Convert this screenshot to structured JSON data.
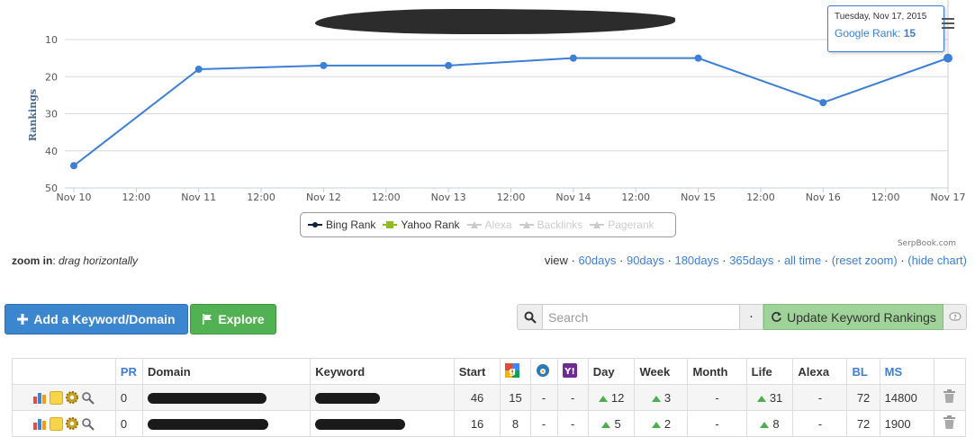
{
  "chart": {
    "y_axis_title": "Rankings",
    "credit": "SerpBook.com",
    "menu_icon": "hamburger-menu-icon"
  },
  "chart_data": {
    "type": "line",
    "title": "",
    "ylabel": "Rankings",
    "ylim": [
      10,
      50
    ],
    "y_reversed": true,
    "y_ticks": [
      10,
      20,
      30,
      40,
      50
    ],
    "x_ticks": [
      "Nov 10",
      "12:00",
      "Nov 11",
      "12:00",
      "Nov 12",
      "12:00",
      "Nov 13",
      "12:00",
      "Nov 14",
      "12:00",
      "Nov 15",
      "12:00",
      "Nov 16",
      "12:00",
      "Nov 17"
    ],
    "x": [
      "Nov 10",
      "Nov 11",
      "Nov 12",
      "Nov 13",
      "Nov 14",
      "Nov 15",
      "Nov 16",
      "Nov 17"
    ],
    "series": [
      {
        "name": "Google Rank",
        "color": "#3b7fd6",
        "values": [
          44,
          18,
          17,
          17,
          15,
          15,
          27,
          15
        ]
      }
    ],
    "grid": true,
    "legend_placement": "bottom-center"
  },
  "tooltip": {
    "date": "Tuesday, Nov 17, 2015",
    "label": "Google Rank:",
    "value": "15"
  },
  "legend": {
    "items": [
      {
        "label": "Bing Rank",
        "color": "#0d233a",
        "active": true
      },
      {
        "label": "Yahoo Rank",
        "color": "#8bbc21",
        "active": true
      },
      {
        "label": "Alexa",
        "color": "#cccccc",
        "active": false
      },
      {
        "label": "Backlinks",
        "color": "#cccccc",
        "active": false
      },
      {
        "label": "Pagerank",
        "color": "#cccccc",
        "active": false
      }
    ]
  },
  "zoom": {
    "label": "zoom in",
    "hint": "drag horizontally"
  },
  "view": {
    "label": "view",
    "links": [
      "60days",
      "90days",
      "180days",
      "365days",
      "all time",
      "(reset zoom)",
      "(hide chart)"
    ]
  },
  "buttons": {
    "add_label": "Add a Keyword/Domain",
    "explore_label": "Explore",
    "update_label": "Update Keyword Rankings"
  },
  "search": {
    "placeholder": "Search",
    "dot": "·"
  },
  "table": {
    "headers": {
      "pr": "PR",
      "domain": "Domain",
      "keyword": "Keyword",
      "start": "Start",
      "day": "Day",
      "week": "Week",
      "month": "Month",
      "life": "Life",
      "alexa": "Alexa",
      "bl": "BL",
      "ms": "MS"
    },
    "rows": [
      {
        "pr": "0",
        "start": "46",
        "google": "15",
        "bing": "-",
        "yahoo": "-",
        "day": "12",
        "week": "3",
        "month": "-",
        "life": "31",
        "alexa": "-",
        "bl": "72",
        "ms": "14800"
      },
      {
        "pr": "0",
        "start": "16",
        "google": "8",
        "bing": "-",
        "yahoo": "-",
        "day": "5",
        "week": "2",
        "month": "-",
        "life": "8",
        "alexa": "-",
        "bl": "72",
        "ms": "1900"
      }
    ]
  },
  "colors": {
    "primary": "#3b86cf",
    "success": "#52b152",
    "update_green": "#9fd39a",
    "link": "#3b7fd6"
  }
}
